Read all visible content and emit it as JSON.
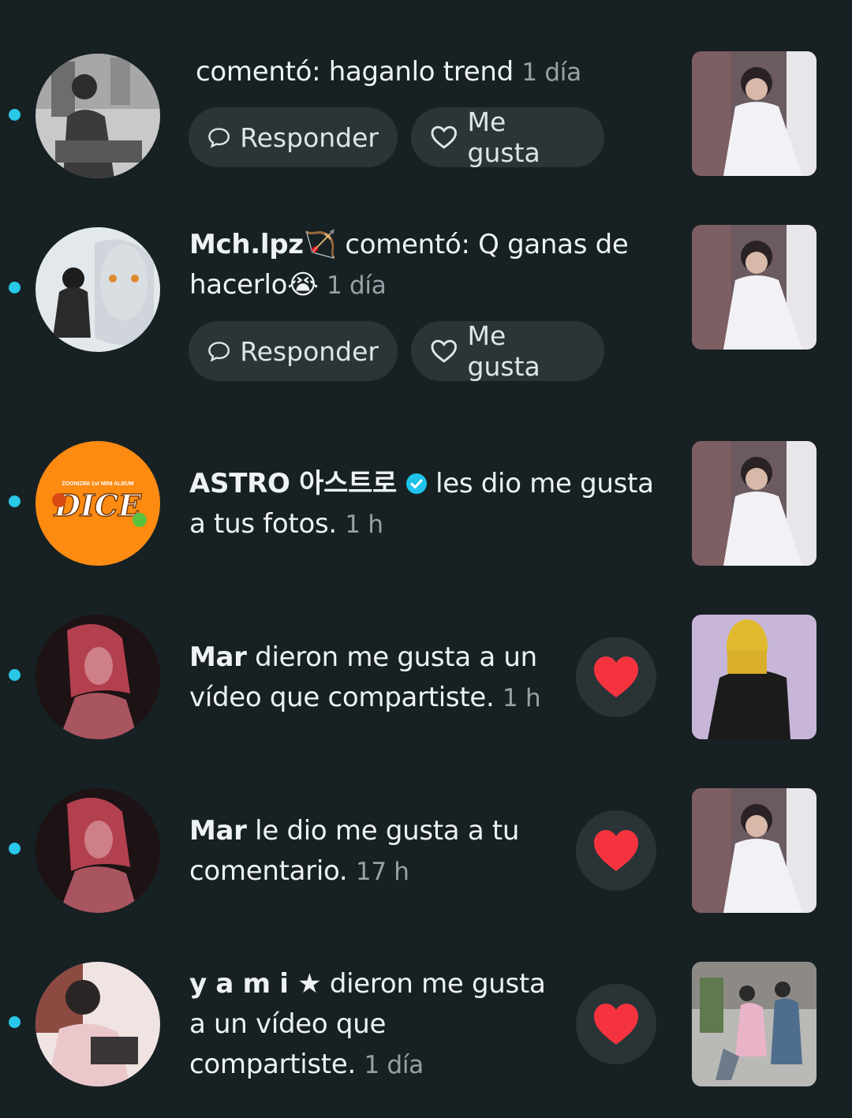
{
  "colors": {
    "background": "#172023",
    "unread_dot": "#29c7e8",
    "pill": "#2b3538",
    "heart": "#f5333f"
  },
  "action_labels": {
    "reply": "Responder",
    "like": "Me gusta"
  },
  "notifications": [
    {
      "user": "",
      "text": "comentó: haganlo trend",
      "time": "1 día",
      "has_actions": true
    },
    {
      "user": "Mch.lpz🏹",
      "text": "comentó: Q ganas de",
      "text2": "hacerlo😭",
      "time": "1 día",
      "has_actions": true
    },
    {
      "user": "ASTRO 아스트로",
      "verified": true,
      "text": "les dio me gusta",
      "text2": "a tus fotos.",
      "time": "1 h",
      "avatar_text": "ZOONIZINI 1st MINI ALBUM",
      "avatar_logo": "DICE"
    },
    {
      "user": "Mar",
      "text": "dieron me gusta a un",
      "text2": "vídeo que compartiste.",
      "time": "1 h",
      "heart_button": true
    },
    {
      "user": "Mar",
      "text": "le dio me gusta a tu",
      "text2": "comentario.",
      "time": "17 h",
      "heart_button": true
    },
    {
      "user": "y a m i ★",
      "text": "dieron me gusta",
      "text2": "a un vídeo que",
      "text3": "compartiste.",
      "time": "1 día",
      "heart_button": true
    }
  ]
}
